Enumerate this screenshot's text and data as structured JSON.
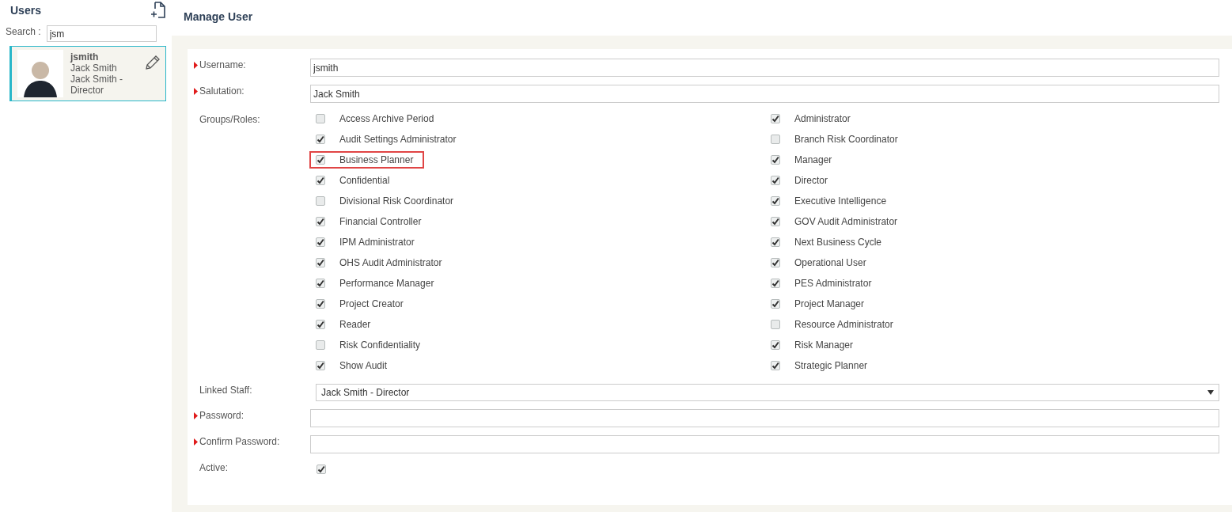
{
  "sidebar": {
    "title": "Users",
    "search": {
      "label": "Search :",
      "value": "jsm"
    },
    "users": [
      {
        "username": "jsmith",
        "name": "Jack Smith",
        "staff": "Jack Smith - Director",
        "selected": true
      }
    ]
  },
  "main": {
    "title": "Manage User",
    "fields": [
      {
        "kind": "text",
        "label": "Username:",
        "required": true,
        "value": "jsmith"
      },
      {
        "kind": "text",
        "label": "Salutation:",
        "required": true,
        "value": "Jack Smith"
      },
      {
        "kind": "roles",
        "label": "Groups/Roles:",
        "required": false,
        "roles": [
          {
            "label": "Access Archive Period",
            "checked": false,
            "highlighted": false
          },
          {
            "label": "Administrator",
            "checked": true,
            "highlighted": false
          },
          {
            "label": "Audit Settings Administrator",
            "checked": true,
            "highlighted": false
          },
          {
            "label": "Branch Risk Coordinator",
            "checked": false,
            "highlighted": false
          },
          {
            "label": "Business Planner",
            "checked": true,
            "highlighted": true
          },
          {
            "label": "Manager",
            "checked": true,
            "highlighted": false
          },
          {
            "label": "Confidential",
            "checked": true,
            "highlighted": false
          },
          {
            "label": "Director",
            "checked": true,
            "highlighted": false
          },
          {
            "label": "Divisional Risk Coordinator",
            "checked": false,
            "highlighted": false
          },
          {
            "label": "Executive Intelligence",
            "checked": true,
            "highlighted": false
          },
          {
            "label": "Financial Controller",
            "checked": true,
            "highlighted": false
          },
          {
            "label": "GOV Audit Administrator",
            "checked": true,
            "highlighted": false
          },
          {
            "label": "IPM Administrator",
            "checked": true,
            "highlighted": false
          },
          {
            "label": "Next Business Cycle",
            "checked": true,
            "highlighted": false
          },
          {
            "label": "OHS Audit Administrator",
            "checked": true,
            "highlighted": false
          },
          {
            "label": "Operational User",
            "checked": true,
            "highlighted": false
          },
          {
            "label": "Performance Manager",
            "checked": true,
            "highlighted": false
          },
          {
            "label": "PES Administrator",
            "checked": true,
            "highlighted": false
          },
          {
            "label": "Project Creator",
            "checked": true,
            "highlighted": false
          },
          {
            "label": "Project Manager",
            "checked": true,
            "highlighted": false
          },
          {
            "label": "Reader",
            "checked": true,
            "highlighted": false
          },
          {
            "label": "Resource Administrator",
            "checked": false,
            "highlighted": false
          },
          {
            "label": "Risk Confidentiality",
            "checked": false,
            "highlighted": false
          },
          {
            "label": "Risk Manager",
            "checked": true,
            "highlighted": false
          },
          {
            "label": "Show Audit",
            "checked": true,
            "highlighted": false
          },
          {
            "label": "Strategic Planner",
            "checked": true,
            "highlighted": false
          }
        ]
      },
      {
        "kind": "select",
        "label": "Linked Staff:",
        "required": false,
        "value": "Jack Smith - Director"
      },
      {
        "kind": "password",
        "label": "Password:",
        "required": true
      },
      {
        "kind": "password",
        "label": "Confirm Password:",
        "required": true
      },
      {
        "kind": "checkbox",
        "label": "Active:",
        "required": false,
        "checked": true
      }
    ]
  }
}
